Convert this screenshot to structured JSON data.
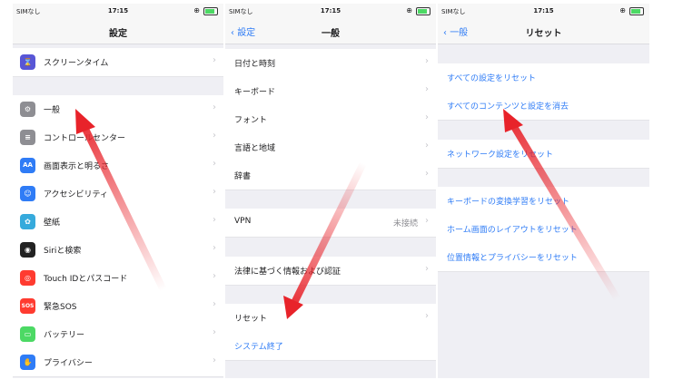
{
  "status": {
    "carrier": "SIMなし",
    "time": "17:15"
  },
  "s1": {
    "title": "設定",
    "items": [
      {
        "label": "スクリーンタイム",
        "icon": "hourglass-icon",
        "color": "#5856d6",
        "glyph": "⌛"
      },
      {
        "label": "一般",
        "icon": "gear-icon",
        "color": "#8e8e93",
        "glyph": "⚙"
      },
      {
        "label": "コントロールセンター",
        "icon": "control-center-icon",
        "color": "#8e8e93",
        "glyph": "≡"
      },
      {
        "label": "画面表示と明るさ",
        "icon": "display-icon",
        "color": "#2f7cf6",
        "glyph": "AA"
      },
      {
        "label": "アクセシビリティ",
        "icon": "accessibility-icon",
        "color": "#2f7cf6",
        "glyph": "☺"
      },
      {
        "label": "壁紙",
        "icon": "wallpaper-icon",
        "color": "#36aadc",
        "glyph": "✿"
      },
      {
        "label": "Siriと検索",
        "icon": "siri-icon",
        "color": "#222222",
        "glyph": "◉"
      },
      {
        "label": "Touch IDとパスコード",
        "icon": "fingerprint-icon",
        "color": "#ff3b30",
        "glyph": "◎"
      },
      {
        "label": "緊急SOS",
        "icon": "sos-icon",
        "color": "#ff3b30",
        "glyph": "SOS"
      },
      {
        "label": "バッテリー",
        "icon": "battery-icon",
        "color": "#4cd964",
        "glyph": "▭"
      },
      {
        "label": "プライバシー",
        "icon": "privacy-hand-icon",
        "color": "#2f7cf6",
        "glyph": "✋"
      }
    ]
  },
  "s2": {
    "back": "設定",
    "title": "一般",
    "items": [
      {
        "label": "日付と時刻"
      },
      {
        "label": "キーボード"
      },
      {
        "label": "フォント"
      },
      {
        "label": "言語と地域"
      },
      {
        "label": "辞書"
      },
      {
        "label": "VPN",
        "detail": "未接続"
      },
      {
        "label": "法律に基づく情報および認証"
      },
      {
        "label": "リセット"
      },
      {
        "label": "システム終了"
      }
    ]
  },
  "s3": {
    "back": "一般",
    "title": "リセット",
    "items": [
      {
        "label": "すべての設定をリセット"
      },
      {
        "label": "すべてのコンテンツと設定を消去"
      },
      {
        "label": "ネットワーク設定をリセット"
      },
      {
        "label": "キーボードの変換学習をリセット"
      },
      {
        "label": "ホーム画面のレイアウトをリセット"
      },
      {
        "label": "位置情報とプライバシーをリセット"
      }
    ]
  },
  "colors": {
    "accent": "#2f7cf6",
    "arrow": "#e8232a"
  }
}
